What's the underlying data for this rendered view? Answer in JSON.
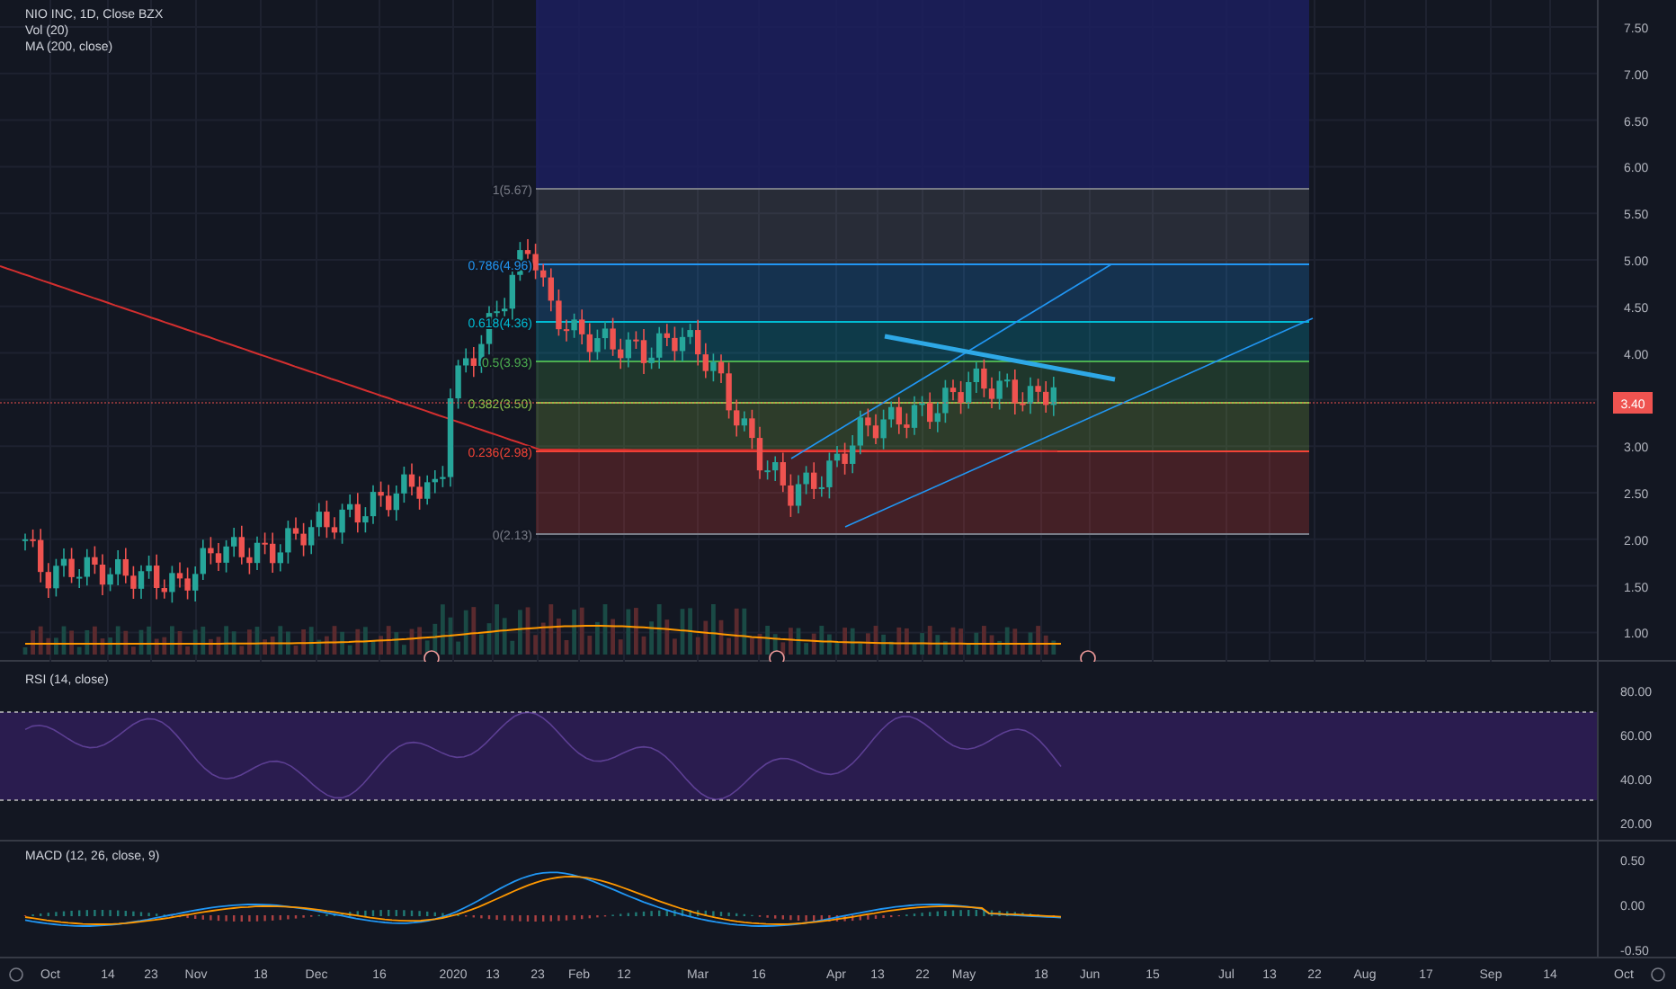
{
  "legend": {
    "symbol": "NIO INC, 1D, Close BZX",
    "volume": "Vol (20)",
    "moving_average": "MA (200, close)"
  },
  "price_axis": [
    "7.50",
    "7.00",
    "6.50",
    "6.00",
    "5.50",
    "5.00",
    "4.50",
    "4.00",
    "3.00",
    "2.50",
    "2.00",
    "1.50",
    "1.00"
  ],
  "current_price": {
    "label": "3.40"
  },
  "fib_levels": [
    {
      "label": "1(5.67)",
      "color": "#787b86"
    },
    {
      "label": "0.786(4.96)",
      "color": "#2196f3"
    },
    {
      "label": "0.618(4.36)",
      "color": "#00bcd4"
    },
    {
      "label": "0.5(3.93)",
      "color": "#4caf50"
    },
    {
      "label": "0.382(3.50)",
      "color": "#8bc34a"
    },
    {
      "label": "0.236(2.98)",
      "color": "#f44336"
    },
    {
      "label": "0(2.13)",
      "color": "#787b86"
    }
  ],
  "rsi": {
    "legend": "RSI (14, close)",
    "axis": [
      "80.00",
      "60.00",
      "40.00",
      "20.00"
    ]
  },
  "macd": {
    "legend": "MACD (12, 26, close, 9)",
    "axis": [
      "0.50",
      "0.00",
      "-0.50"
    ]
  },
  "time_axis": [
    "Oct",
    "14",
    "23",
    "Nov",
    "18",
    "Dec",
    "16",
    "2020",
    "13",
    "23",
    "Feb",
    "12",
    "Mar",
    "16",
    "Apr",
    "13",
    "22",
    "May",
    "18",
    "Jun",
    "15",
    "Jul",
    "13",
    "22",
    "Aug",
    "17",
    "Sep",
    "14",
    "Oct"
  ]
}
